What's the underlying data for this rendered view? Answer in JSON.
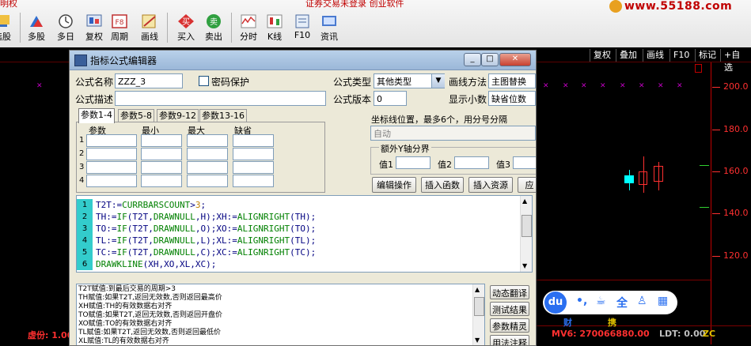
{
  "top_banner": {
    "left_text": "明权",
    "center_text": "证券交易未登录   创业软件"
  },
  "logo_text": "www.55188.com",
  "toolbar": [
    {
      "label": "选股",
      "icon": "select-stock-icon"
    },
    {
      "label": "多股",
      "icon": "multi-stock-icon"
    },
    {
      "label": "多日",
      "icon": "multi-day-icon"
    },
    {
      "label": "复权",
      "icon": "restore-rights-icon"
    },
    {
      "label": "周期",
      "icon": "period-icon",
      "glyph": "F8"
    },
    {
      "label": "画线",
      "icon": "draw-line-icon"
    },
    {
      "label": "买入",
      "icon": "buy-icon",
      "glyph": "买"
    },
    {
      "label": "卖出",
      "icon": "sell-icon",
      "glyph": "卖"
    },
    {
      "label": "分时",
      "icon": "intraday-icon"
    },
    {
      "label": "K线",
      "icon": "kline-icon"
    },
    {
      "label": "F10",
      "icon": "f10-icon"
    },
    {
      "label": "资讯",
      "icon": "news-icon"
    }
  ],
  "right_bar": [
    "复权",
    "叠加",
    "画线",
    "F10",
    "标记",
    "+自选"
  ],
  "y_axis": [
    "200.0",
    "180.0",
    "160.0",
    "140.0",
    "120.0"
  ],
  "dialog": {
    "title": "指标公式编辑器",
    "formula_name_label": "公式名称",
    "formula_name_value": "ZZZ_3",
    "password_label": "密码保护",
    "formula_type_label": "公式类型",
    "formula_type_value": "其他类型",
    "draw_method_label": "画线方法",
    "draw_method_value": "主图替换",
    "formula_desc_label": "公式描述",
    "formula_version_label": "公式版本",
    "formula_version_value": "0",
    "decimal_label": "显示小数",
    "decimal_value": "缺省位数",
    "tabs": [
      "参数1-4",
      "参数5-8",
      "参数9-12",
      "参数13-16"
    ],
    "param_headers": [
      "参数",
      "最小",
      "最大",
      "缺省"
    ],
    "param_rows": [
      "1",
      "2",
      "3",
      "4"
    ],
    "coord_label": "坐标线位置，最多6个，用分号分隔",
    "coord_value": "自动",
    "extra_y_label": "额外Y轴分界",
    "extra_y_values": [
      "值1",
      "值2",
      "值3"
    ],
    "buttons": [
      "编辑操作",
      "插入函数",
      "插入资源",
      "应"
    ],
    "code_lines": [
      "T2T:=CURRBARSCOUNT>3;",
      "TH:=IF(T2T,DRAWNULL,H);XH:=ALIGNRIGHT(TH);",
      "TO:=IF(T2T,DRAWNULL,O);XO:=ALIGNRIGHT(TO);",
      "TL:=IF(T2T,DRAWNULL,L);XL:=ALIGNRIGHT(TL);",
      "TC:=IF(T2T,DRAWNULL,C);XC:=ALIGNRIGHT(TC);",
      "DRAWKLINE(XH,XO,XL,XC);"
    ],
    "line_numbers": [
      "1",
      "2",
      "3",
      "4",
      "5",
      "6"
    ],
    "help_lines": [
      "T2T赋值:到最后交易的周期>3",
      "TH赋值:如果T2T,返回无效数,否则返回最高价",
      "XH赋值:TH的有效数据右对齐",
      "TO赋值:如果T2T,返回无效数,否则返回开盘价",
      "XO赋值:TO的有效数据右对齐",
      "TL赋值:如果T2T,返回无效数,否则返回最低价",
      "XL赋值:TL的有效数据右对齐"
    ],
    "side_buttons": [
      "动态翻译",
      "测试结果",
      "参数精灵",
      "用法注释"
    ]
  },
  "status": {
    "left": "虚份: 1.00",
    "mv6": "MV6: 270066880.00",
    "ldt": "LDT: 0.00",
    "zc": "ZC"
  },
  "du_panel": {
    "label": "du",
    "under_labels": [
      "财",
      "携"
    ]
  }
}
